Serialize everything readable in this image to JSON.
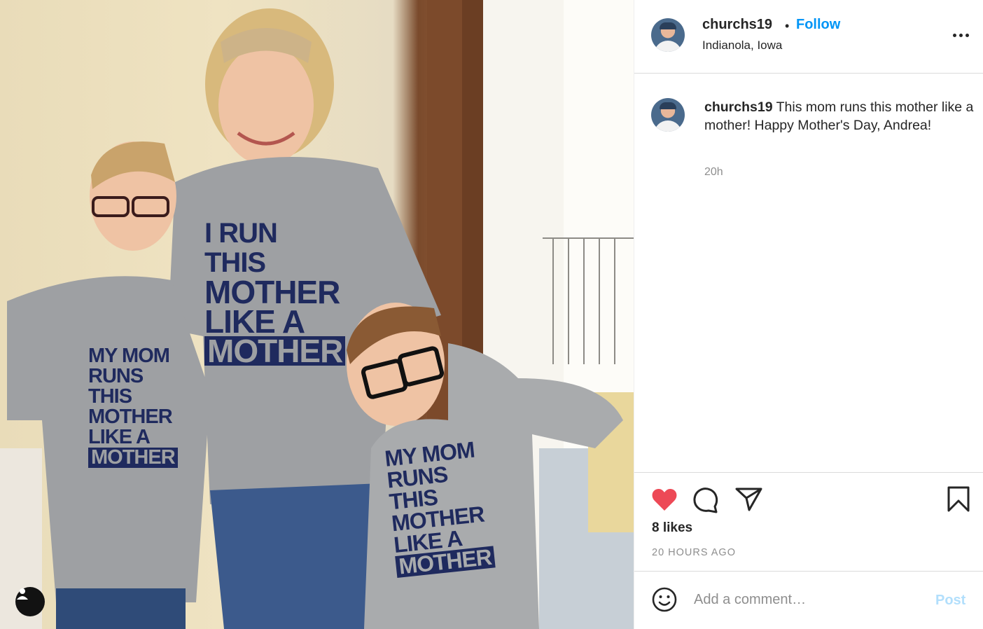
{
  "photo": {
    "user_tag_icon": "user-silhouette-icon",
    "shirt_texts": {
      "mom": [
        "I RUN",
        "THIS",
        "MOTHER",
        "LIKE A",
        "MOTHER"
      ],
      "left_boy": [
        "MY MOM",
        "RUNS",
        "THIS",
        "MOTHER",
        "LIKE A",
        "MOTHER"
      ],
      "right_boy": [
        "MY MOM",
        "RUNS",
        "THIS",
        "MOTHER",
        "LIKE A",
        "MOTHER"
      ]
    }
  },
  "header": {
    "username": "churchs19",
    "separator": "•",
    "follow_label": "Follow",
    "location": "Indianola, Iowa",
    "more_icon": "more-horizontal-icon"
  },
  "caption": {
    "username": "churchs19",
    "text": "This mom runs this mother like a mother! Happy Mother's Day, Andrea!",
    "time": "20h"
  },
  "actions": {
    "like_icon": "heart-filled-icon",
    "comment_icon": "comment-icon",
    "share_icon": "send-icon",
    "save_icon": "bookmark-icon",
    "likes_text": "8 likes",
    "posted_text": "20 HOURS AGO"
  },
  "comment": {
    "emoji_icon": "emoji-icon",
    "placeholder": "Add a comment…",
    "post_label": "Post"
  },
  "colors": {
    "accent": "#0095f6",
    "like": "#ed4956",
    "post_disabled": "#b2dffc",
    "shirt_print": "#1f2a5e"
  }
}
